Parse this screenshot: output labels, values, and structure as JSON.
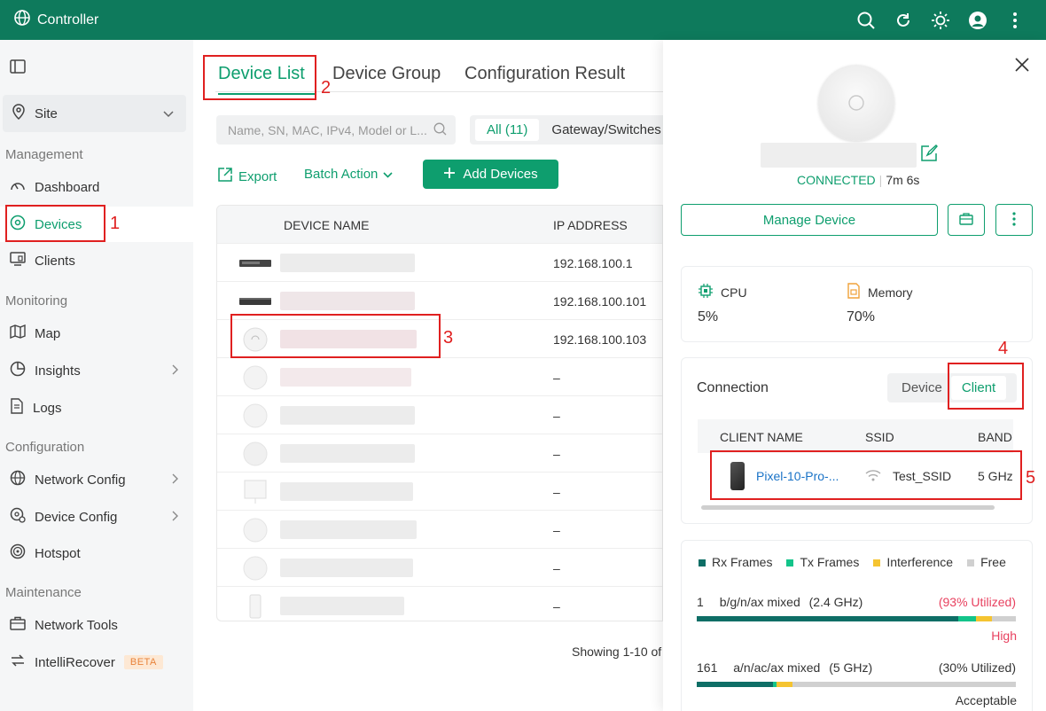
{
  "app": {
    "title": "Controller"
  },
  "sidebar": {
    "site_label": "Site",
    "sections": {
      "management": "Management",
      "monitoring": "Monitoring",
      "configuration": "Configuration",
      "maintenance": "Maintenance"
    },
    "items": {
      "dashboard": "Dashboard",
      "devices": "Devices",
      "clients": "Clients",
      "map": "Map",
      "insights": "Insights",
      "logs": "Logs",
      "network_config": "Network Config",
      "device_config": "Device Config",
      "hotspot": "Hotspot",
      "network_tools": "Network Tools",
      "intellirecover": "IntelliRecover"
    },
    "beta_badge": "BETA"
  },
  "main": {
    "tabs": {
      "device_list": "Device List",
      "device_group": "Device Group",
      "configuration_result": "Configuration Result"
    },
    "search_placeholder": "Name, SN, MAC, IPv4, Model or L...",
    "filter": {
      "all": "All (11)",
      "gateway_switches": "Gateway/Switches"
    },
    "actions": {
      "export": "Export",
      "batch_action": "Batch Action",
      "add_devices": "Add Devices"
    },
    "table": {
      "columns": {
        "device_name": "DEVICE NAME",
        "ip_address": "IP ADDRESS"
      },
      "ips": [
        "192.168.100.1",
        "192.168.100.101",
        "192.168.100.103",
        "–",
        "–",
        "–",
        "–",
        "–",
        "–",
        "–"
      ]
    },
    "showing": "Showing 1-10 of"
  },
  "drawer": {
    "status": "CONNECTED",
    "uptime": "7m 6s",
    "manage_button": "Manage Device",
    "cpu_label": "CPU",
    "cpu_value": "5%",
    "memory_label": "Memory",
    "memory_value": "70%",
    "connection_title": "Connection",
    "seg_device": "Device",
    "seg_client": "Client",
    "client_columns": {
      "client_name": "CLIENT NAME",
      "ssid": "SSID",
      "band": "BAND"
    },
    "client": {
      "name": "Pixel-10-Pro-...",
      "ssid": "Test_SSID",
      "band": "5 GHz"
    },
    "legend": {
      "rx": "Rx Frames",
      "tx": "Tx Frames",
      "interference": "Interference",
      "free": "Free"
    },
    "radios": [
      {
        "channel": "1",
        "mode": "b/g/n/ax mixed",
        "freq": "(2.4 GHz)",
        "utilized": "(93% Utilized)",
        "level": "High",
        "rx_fraction": 0.82,
        "tx_fraction": 0.055,
        "interference_fraction": 0.05
      },
      {
        "channel": "161",
        "mode": "a/n/ac/ax mixed",
        "freq": "(5 GHz)",
        "utilized": "(30% Utilized)",
        "level": "Acceptable",
        "rx_fraction": 0.24,
        "tx_fraction": 0.01,
        "interference_fraction": 0.05
      }
    ]
  },
  "annotations": [
    "1",
    "2",
    "3",
    "4",
    "5"
  ],
  "colors": {
    "brand": "#0e7a5c",
    "accent": "#0e9e6e",
    "rx": "#0e6e66",
    "tx": "#13c48a",
    "interference": "#f5c431",
    "free": "#d0d0d0",
    "high": "#e8415f",
    "annotation": "#e02020"
  }
}
